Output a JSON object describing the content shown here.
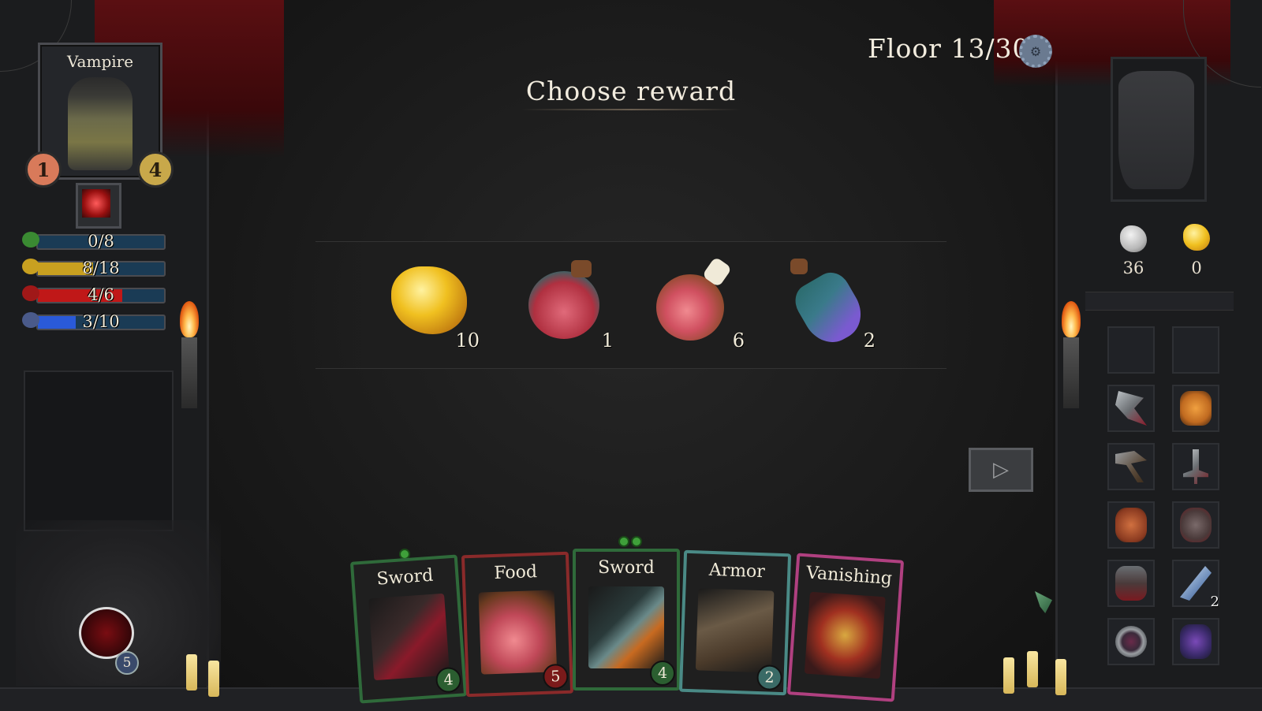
{
  "hud": {
    "floor_label": "Floor 13/30",
    "settings_icon": "gear-icon"
  },
  "character": {
    "name": "Vampire",
    "attack": "1",
    "defense": "4",
    "ability_icon": "blood-claw-icon"
  },
  "stats": [
    {
      "icon": "clover-icon",
      "text": "0/8",
      "value": 0,
      "max": 8,
      "color": "#3a8a32"
    },
    {
      "icon": "gold-icon",
      "text": "8/18",
      "value": 8,
      "max": 18,
      "color": "#c8a020"
    },
    {
      "icon": "heart-icon",
      "text": "4/6",
      "value": 4,
      "max": 6,
      "color": "#c01818"
    },
    {
      "icon": "mana-orb-icon",
      "text": "3/10",
      "value": 3,
      "max": 10,
      "color": "#2a5ad8"
    }
  ],
  "gargoyle": {
    "count": "5"
  },
  "reward": {
    "title": "Choose reward",
    "items": [
      {
        "name": "gold-nugget",
        "count": "10"
      },
      {
        "name": "health-potion",
        "count": "1"
      },
      {
        "name": "meat-leg",
        "count": "6"
      },
      {
        "name": "mana-potion",
        "count": "2"
      }
    ]
  },
  "hand": [
    {
      "title": "Sword",
      "cost": "4",
      "dots": 1,
      "border": "#2f6a3a",
      "cost_color": "#2b5e30",
      "art": "crimson-sword-art"
    },
    {
      "title": "Food",
      "cost": "5",
      "dots": 0,
      "border": "#8a2a2a",
      "cost_color": "#7a1a1a",
      "art": "meat-art"
    },
    {
      "title": "Sword",
      "cost": "4",
      "dots": 2,
      "border": "#2f6a3a",
      "cost_color": "#2b5e30",
      "art": "steel-sword-art"
    },
    {
      "title": "Armor",
      "cost": "2",
      "dots": 0,
      "border": "#4a8a86",
      "cost_color": "#3a6a66",
      "art": "armor-art"
    },
    {
      "title": "Vanishing",
      "cost": "",
      "dots": 0,
      "border": "#b04080",
      "cost_color": "#6a1a4a",
      "art": "vanishing-art"
    }
  ],
  "resources": [
    {
      "icon": "silver-ore-icon",
      "count": "36"
    },
    {
      "icon": "gold-ore-icon",
      "count": "0"
    }
  ],
  "inventory": [
    {
      "icon": "empty-slot",
      "count": ""
    },
    {
      "icon": "empty-slot",
      "count": ""
    },
    {
      "icon": "battle-axe-icon",
      "count": ""
    },
    {
      "icon": "tentacle-icon",
      "count": ""
    },
    {
      "icon": "pickaxe-icon",
      "count": ""
    },
    {
      "icon": "dagger-icon",
      "count": ""
    },
    {
      "icon": "claw-icon",
      "count": ""
    },
    {
      "icon": "lantern-icon",
      "count": ""
    },
    {
      "icon": "barrel-icon",
      "count": ""
    },
    {
      "icon": "feather-icon",
      "count": "2"
    },
    {
      "icon": "eye-ring-icon",
      "count": ""
    },
    {
      "icon": "shadow-icon",
      "count": ""
    }
  ]
}
